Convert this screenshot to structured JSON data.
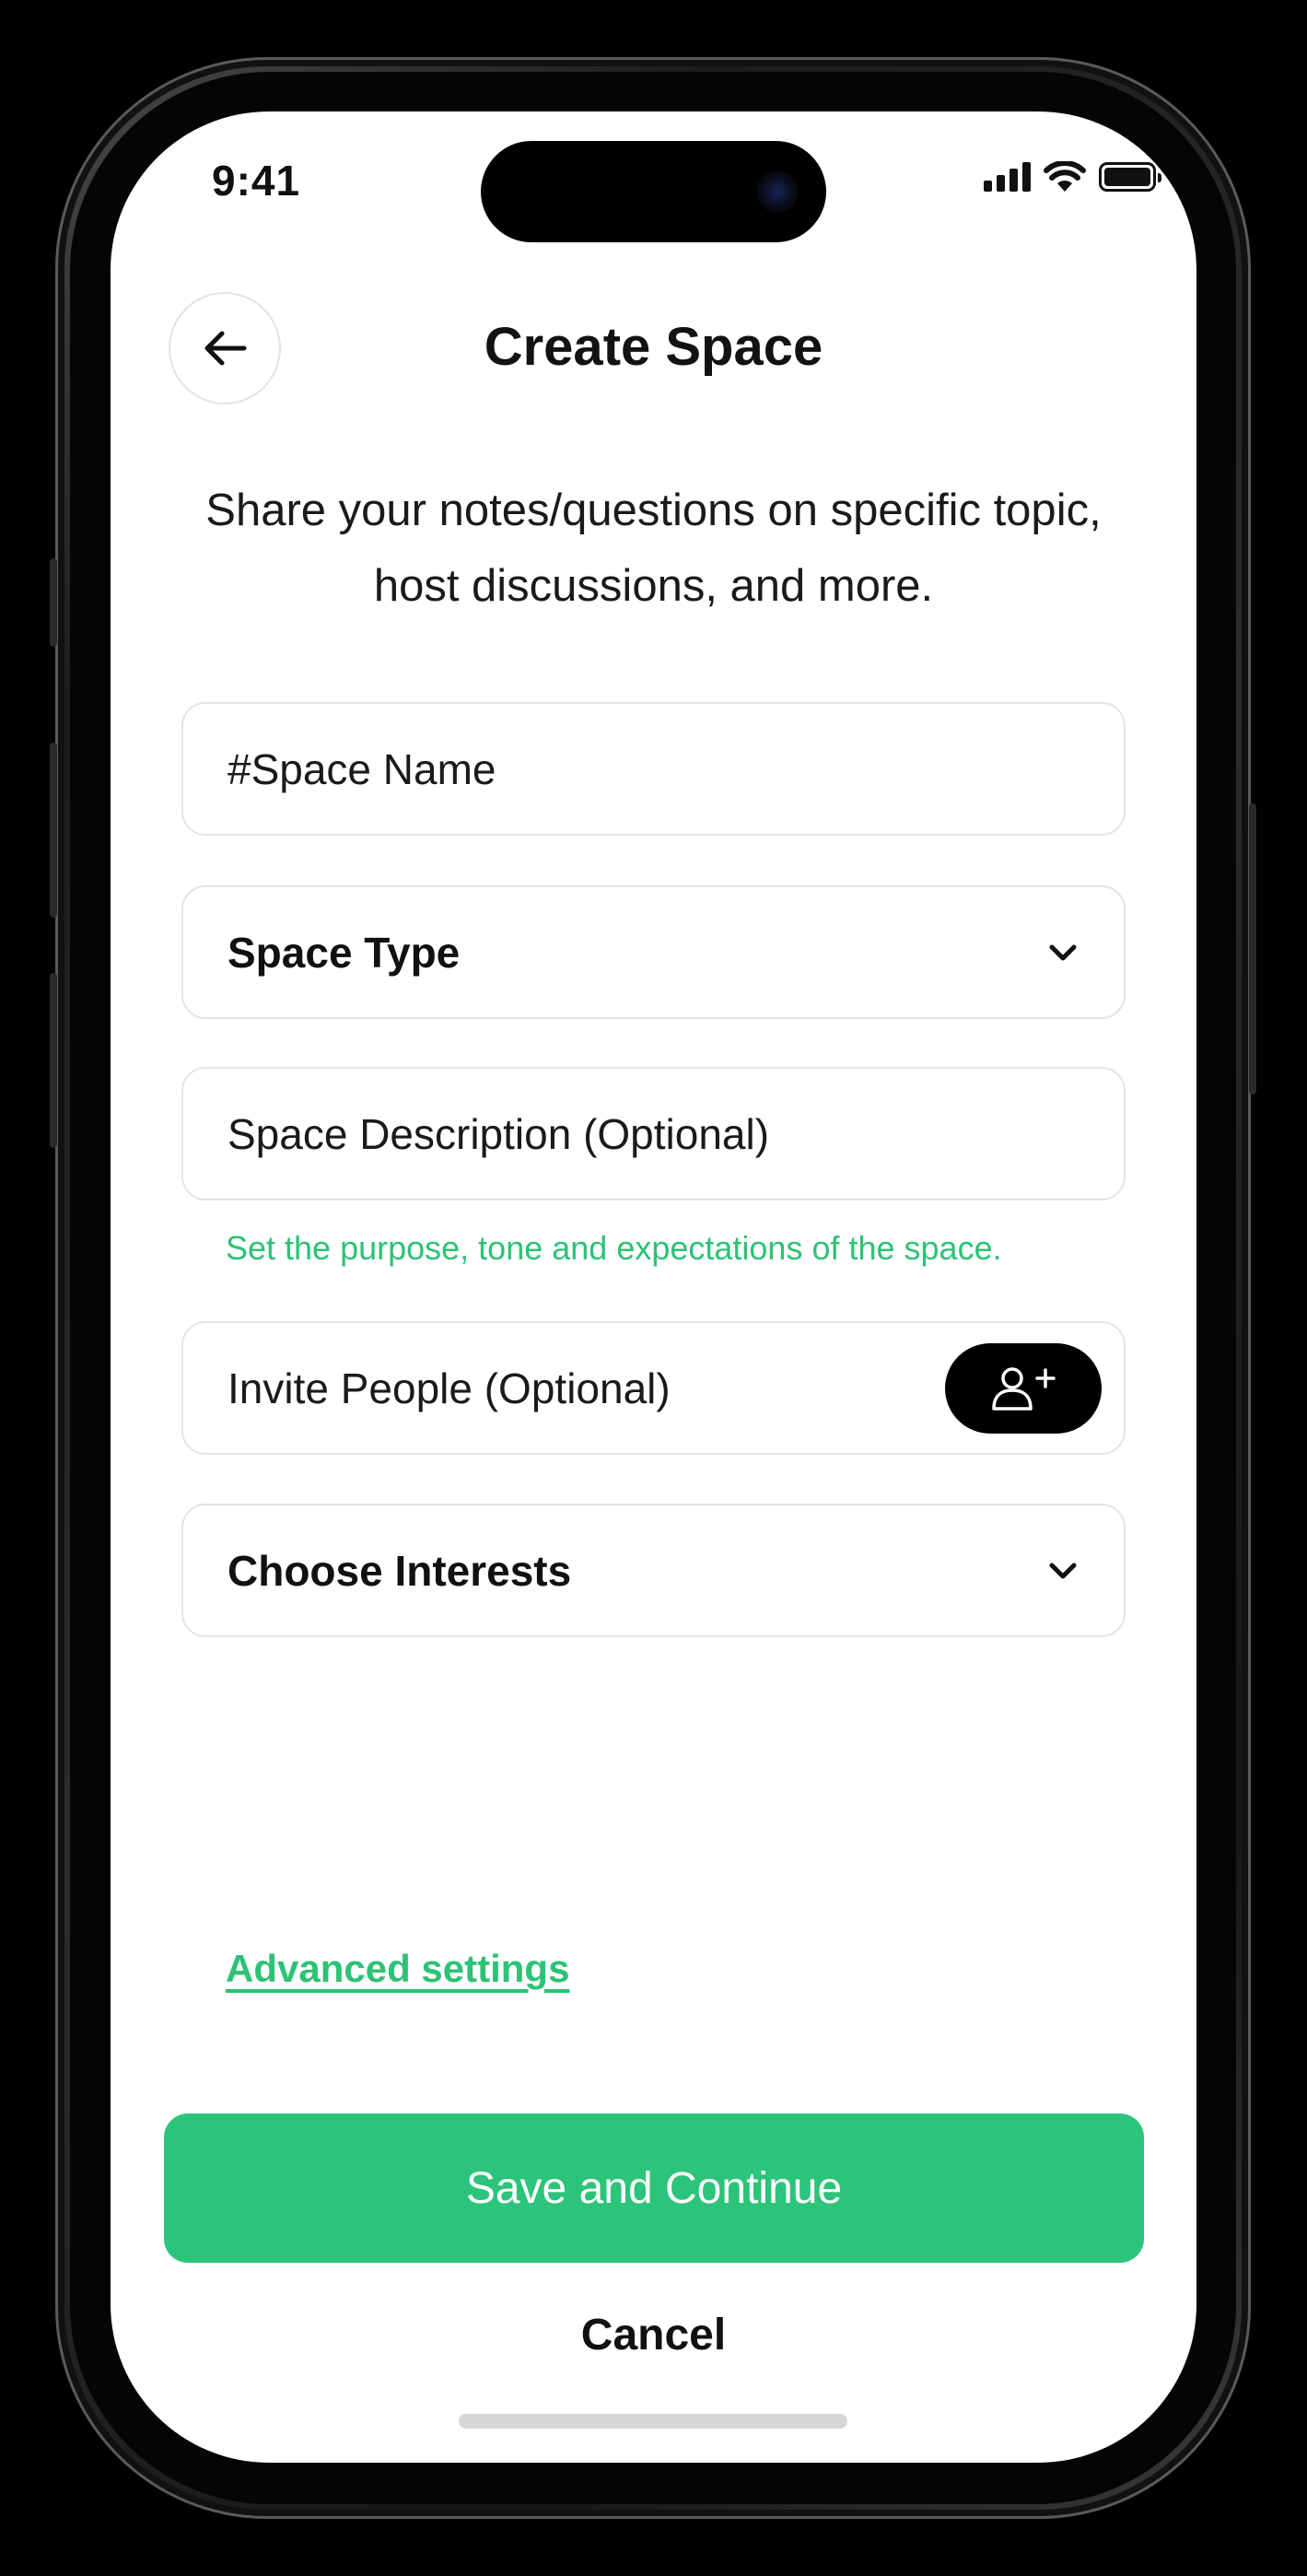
{
  "status_bar": {
    "time": "9:41"
  },
  "header": {
    "title": "Create Space",
    "back_icon": "arrow-left-icon"
  },
  "subtitle": "Share your notes/questions on specific topic, host discussions, and more.",
  "form": {
    "space_name_placeholder": "#Space Name",
    "space_type_label": "Space Type",
    "space_description_placeholder": "Space Description (Optional)",
    "description_helper": "Set the purpose, tone and expectations of the space.",
    "invite_people_label": "Invite People (Optional)",
    "invite_icon": "add-user-icon",
    "choose_interests_label": "Choose Interests"
  },
  "advanced_settings_label": "Advanced settings",
  "primary_button_label": "Save and Continue",
  "cancel_label": "Cancel",
  "colors": {
    "accent": "#2CC47A",
    "text": "#111111",
    "field_border": "#E4E4E4"
  }
}
